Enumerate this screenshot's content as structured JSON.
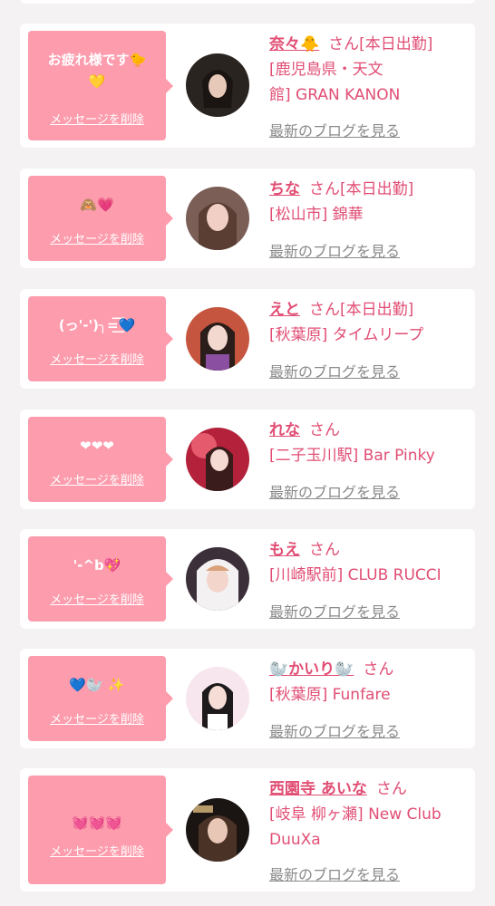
{
  "common": {
    "delete_label": "メッセージを削除",
    "blog_label": "最新のブログを見る"
  },
  "colors": {
    "bubble": "#fd9cad",
    "name": "#e14e74",
    "link_gray": "#8a8a8a"
  },
  "cards": [
    {
      "message": "お疲れ様です🐤\n💛",
      "name": "奈々🐥",
      "honorific": "さん[本日出勤]",
      "shop_lines": [
        "[鹿児島県・天文",
        "館] GRAN KANON"
      ]
    },
    {
      "message": "🙈💗",
      "name": "ちな",
      "honorific": "さん[本日出勤]",
      "shop_lines": [
        "[松山市] 錦華"
      ]
    },
    {
      "message": "(っ'-')╮=͟͟͞͞💙",
      "name": "えと",
      "honorific": "さん[本日出勤]",
      "shop_lines": [
        "[秋葉原] タイムリープ"
      ]
    },
    {
      "message": "❤❤❤",
      "name": "れな",
      "honorific": "さん",
      "shop_lines": [
        "[二子玉川駅] Bar Pinky"
      ]
    },
    {
      "message": "'-^b💖",
      "name": "もえ",
      "honorific": "さん",
      "shop_lines": [
        "[川崎駅前] CLUB RUCCI"
      ]
    },
    {
      "message": "💙🦭 ✨",
      "name": "🦭かいり🦭",
      "honorific": "さん",
      "shop_lines": [
        "[秋葉原] Funfare"
      ]
    },
    {
      "message": "💓💓💓",
      "name": "西園寺 あいな",
      "honorific": "さん",
      "shop_lines": [
        "[岐阜 柳ヶ瀬] New Club",
        "DuuXa"
      ]
    }
  ]
}
